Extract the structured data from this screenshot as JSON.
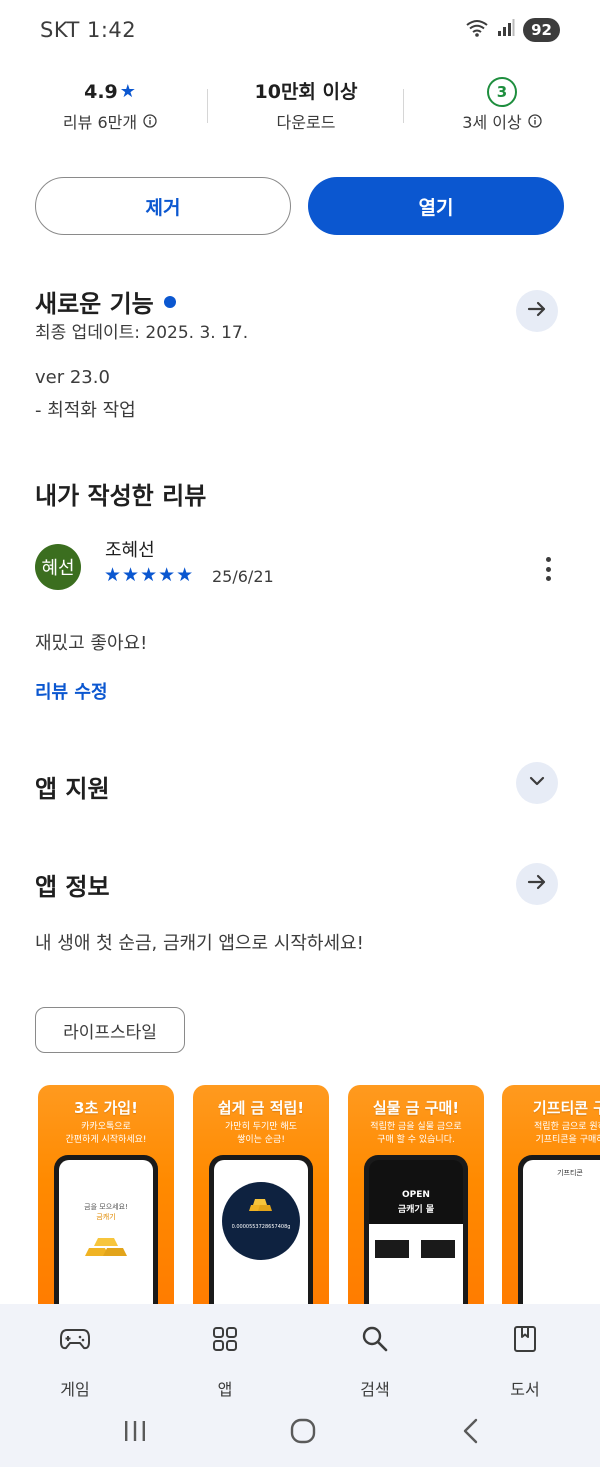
{
  "status_bar": {
    "carrier_time": "SKT 1:42",
    "battery": "92"
  },
  "stats": {
    "rating": {
      "value": "4.9",
      "star": "★",
      "label": "리뷰 6만개"
    },
    "downloads": {
      "value": "10만회 이상",
      "label": "다운로드"
    },
    "age": {
      "badge": "3",
      "label": "3세 이상"
    }
  },
  "buttons": {
    "remove": "제거",
    "open": "열기"
  },
  "whats_new": {
    "title": "새로운 기능",
    "updated": "최종 업데이트: 2025. 3. 17.",
    "version": "ver 23.0",
    "note": "- 최적화 작업"
  },
  "my_review": {
    "title": "내가 작성한 리뷰",
    "avatar_text": "혜선",
    "reviewer": "조혜선",
    "stars": "★★★★★",
    "rating": 5,
    "date": "25/6/21",
    "text": "재밌고 좋아요!",
    "edit_link": "리뷰 수정"
  },
  "app_support": {
    "title": "앱 지원"
  },
  "app_info": {
    "title": "앱 정보",
    "description": "내 생애 첫 순금, 금캐기 앱으로 시작하세요!",
    "category_chip": "라이프스타일"
  },
  "screenshots": [
    {
      "title": "3초 가입!",
      "subtitle_line1": "카카오톡으로",
      "subtitle_line2": "간편하게 시작하세요!",
      "screen_line1": "금을 모으세요!",
      "screen_line2": "금캐기"
    },
    {
      "title": "쉽게 금 적립!",
      "subtitle_line1": "가만히 두기만 해도",
      "subtitle_line2": "쌓이는 순금!",
      "screen_value": "0.0000553728657408g"
    },
    {
      "title": "실물 금 구매!",
      "subtitle_line1": "적립한 금을 실물 금으로",
      "subtitle_line2": "구매 할 수 있습니다.",
      "screen_line1": "OPEN",
      "screen_line2": "금캐기 몰"
    },
    {
      "title": "기프티콘 구",
      "subtitle_line1": "적립한 금으로 원하",
      "subtitle_line2": "기프티콘을 구매하",
      "screen_line1": "기프티콘"
    }
  ],
  "bottom_nav": [
    {
      "label": "게임",
      "icon": "gamepad-icon"
    },
    {
      "label": "앱",
      "icon": "apps-grid-icon"
    },
    {
      "label": "검색",
      "icon": "search-icon"
    },
    {
      "label": "도서",
      "icon": "book-icon"
    }
  ],
  "colors": {
    "accent": "#0b57d0",
    "age_green": "#1e8e3e",
    "avatar_green": "#3b6e1f",
    "promo_orange": "#ff8a00"
  }
}
